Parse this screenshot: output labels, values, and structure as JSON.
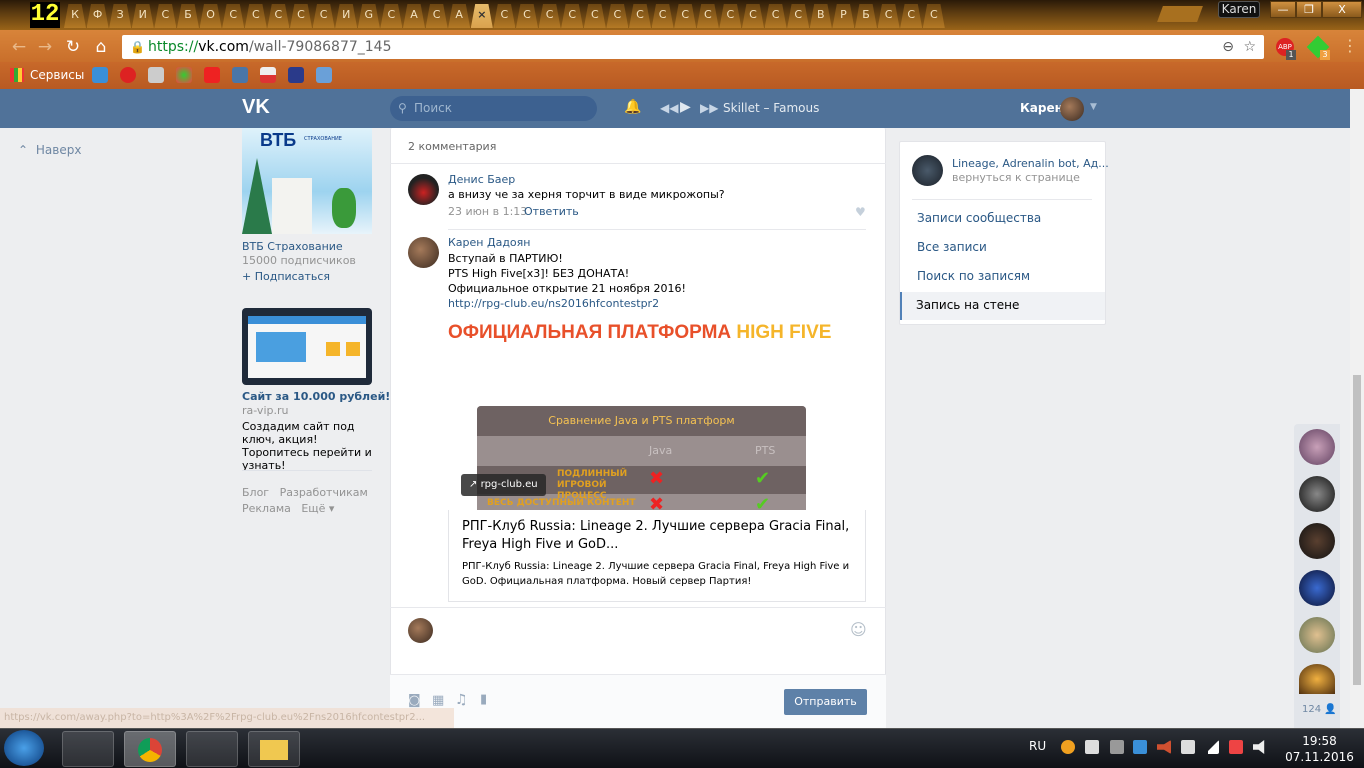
{
  "browser": {
    "tab_counter": "12",
    "tabs": [
      "К",
      "Ф",
      "З",
      "И",
      "С",
      "Б",
      "О",
      "С",
      "С",
      "С",
      "С",
      "С",
      "И",
      "G",
      "С",
      "А",
      "С",
      "А",
      "×",
      "С",
      "С",
      "С",
      "С",
      "С",
      "С",
      "С",
      "С",
      "С",
      "С",
      "С",
      "С",
      "С",
      "С",
      "В",
      "Р",
      "Б",
      "С",
      "С",
      "С"
    ],
    "active_tab_index": 18,
    "profile": "Karen",
    "url_scheme": "https://",
    "url_host": "vk.com",
    "url_path": "/wall-79086877_145",
    "extensions": [
      {
        "name": "ABP",
        "badge": "1"
      },
      {
        "name": "g",
        "badge": "3"
      }
    ],
    "bookmarks_label": "Сервисы",
    "status_url": "https://vk.com/away.php?to=http%3A%2F%2Frpg-club.eu%2Fns2016hfcontestpr2..."
  },
  "header": {
    "search_placeholder": "Поиск",
    "track": "Skillet – Famous",
    "user": "Карен"
  },
  "left": {
    "back_to_top": "Наверх",
    "ad1": {
      "logo": "ВТБ",
      "logo_sub": "СТРАХОВАНИЕ",
      "title": "ВТБ Страхование",
      "subs": "15000 подписчиков",
      "subscribe": "+ Подписаться"
    },
    "ad2": {
      "title": "Сайт за 10.000 рублей!",
      "domain": "ra-vip.ru",
      "text": "Создадим сайт под ключ, акция! Торопитесь перейти и узнать!"
    },
    "footer": [
      "Блог",
      "Разработчикам",
      "Реклама",
      "Ещё ▾"
    ]
  },
  "post": {
    "comments_count": "2 комментария",
    "comments": [
      {
        "author": "Денис Баер",
        "text": "а внизу че за херня торчит в виде микрожопы?",
        "date": "23 июн в 1:13",
        "reply": "Ответить"
      },
      {
        "author": "Карен Дадоян",
        "lines": [
          "Вступай в ПАРТИЮ!",
          "PTS High Five[x3]! БЕЗ ДОНАТА!",
          "Официальное открытие 21 ноября 2016!"
        ],
        "link": "http://rpg-club.eu/ns2016hfcontestpr2"
      }
    ],
    "banner": {
      "title_a": "ОФИЦИАЛЬНАЯ ПЛАТФОРМА ",
      "title_b": "HIGH FIVE",
      "table_title": "Сравнение Java и PTS платформ",
      "col1": "Java",
      "col2": "PTS",
      "row1": "ПОДЛИННЫЙ ИГРОВОЙ ПРОЦЕСС",
      "row2": "ВЕСЬ ДОСТУПНЫЙ КОНТЕНТ",
      "domain": "rpg-club.eu"
    },
    "snippet": {
      "title": "РПГ-Клуб Russia: Lineage 2. Лучшие сервера Gracia Final, Freya High Five и GoD...",
      "desc": "РПГ-Клуб Russia: Lineage 2. Лучшие сервера Gracia Final, Freya High Five и GoD. Официальная платформа. Новый сервер Партия!"
    },
    "send": "Отправить"
  },
  "right": {
    "group": "Lineage, Adrenalin bot, Ад...",
    "back": "вернуться к странице",
    "menu": [
      "Записи сообщества",
      "Все записи",
      "Поиск по записям",
      "Запись на стене"
    ],
    "friends_count": "124"
  },
  "taskbar": {
    "lang": "RU",
    "time": "19:58",
    "date": "07.11.2016"
  }
}
